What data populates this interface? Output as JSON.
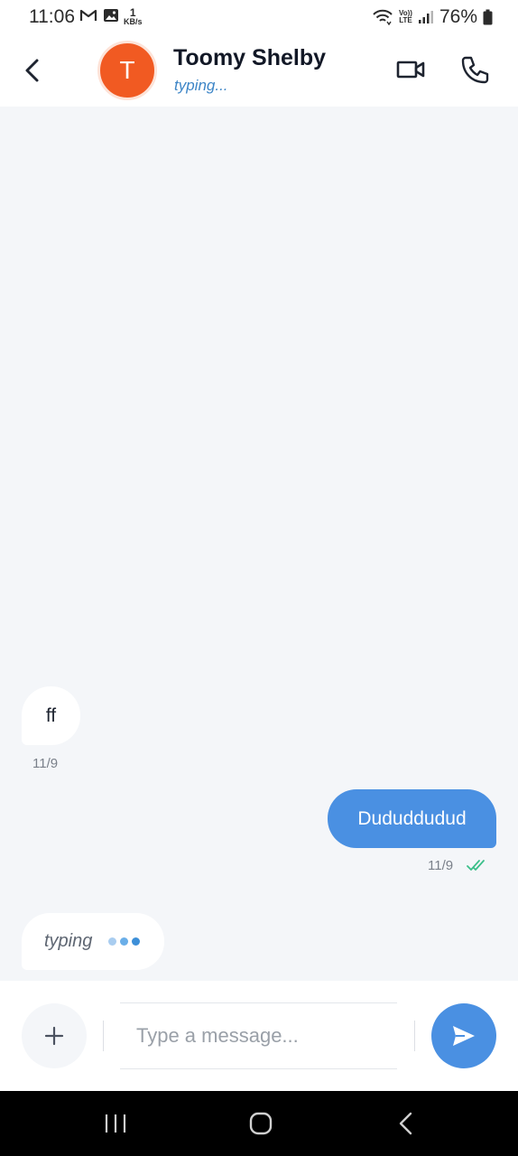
{
  "status_bar": {
    "time": "11:06",
    "speed_value": "1",
    "speed_unit": "KB/s",
    "volte_top": "Vo))",
    "volte_bottom": "LTE",
    "battery": "76%",
    "icons": [
      "gmail-icon",
      "gallery-icon",
      "wifi-icon",
      "volte-icon",
      "signal-icon",
      "battery-icon"
    ]
  },
  "header": {
    "avatar_initial": "T",
    "contact_name": "Toomy Shelby",
    "contact_status": "typing...",
    "accent_color": "#f15a22"
  },
  "messages": [
    {
      "direction": "incoming",
      "text": "ff",
      "time": "11/9"
    },
    {
      "direction": "outgoing",
      "text": "Dududdudud",
      "time": "11/9",
      "read": true
    }
  ],
  "typing_indicator": {
    "label": "typing"
  },
  "composer": {
    "placeholder": "Type a message...",
    "value": ""
  },
  "colors": {
    "primary": "#4a90e2",
    "chat_background": "#f4f6f9",
    "read_check": "#3bbf8a"
  }
}
